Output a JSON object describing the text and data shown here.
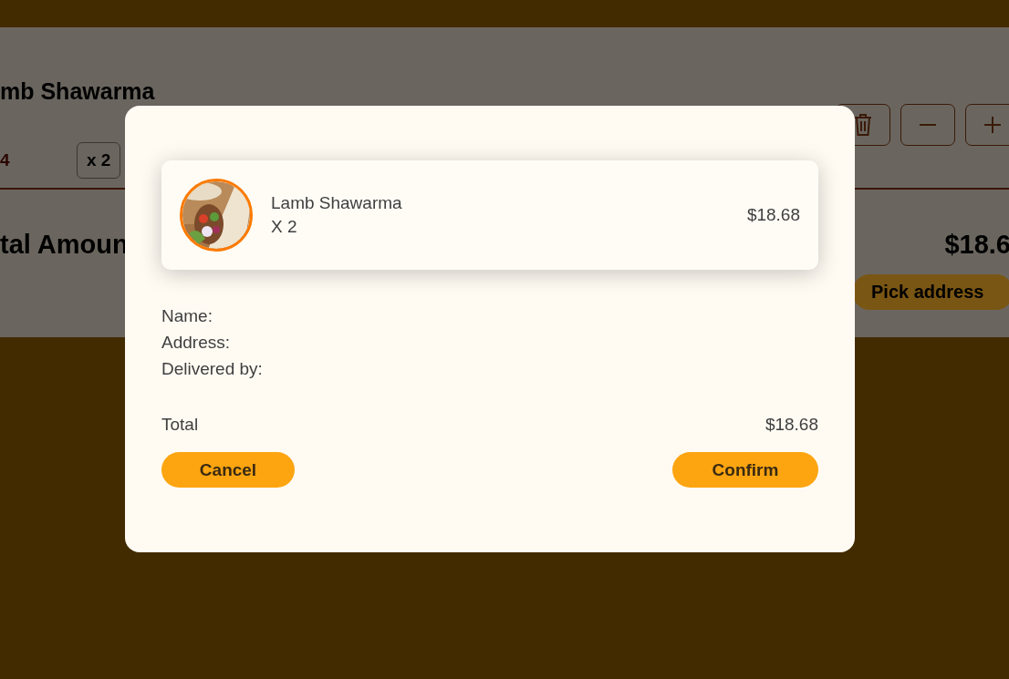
{
  "background_page": {
    "item": {
      "name": "mb Shawarma",
      "price": "4",
      "quantity": "x 2"
    },
    "total": {
      "label": "tal Amoun",
      "amount": "$18.6"
    },
    "pick_address_button": "Pick address"
  },
  "dialog": {
    "order_item": {
      "name": "Lamb Shawarma",
      "quantity": "X 2",
      "price": "$18.68"
    },
    "details": [
      "Name:",
      "Address:",
      "Delivered by:"
    ],
    "total": {
      "label": "Total",
      "amount": "$18.68"
    },
    "buttons": [
      "Cancel",
      "Confirm"
    ]
  }
}
